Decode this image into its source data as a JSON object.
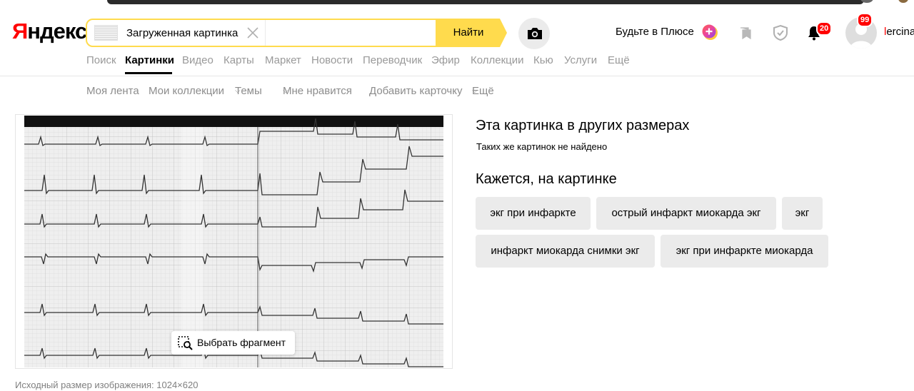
{
  "header": {
    "logo": {
      "first": "Я",
      "rest": "ндекс"
    },
    "search": {
      "query_text": "Загруженная картинка",
      "input_value": "",
      "submit_label": "Найти"
    },
    "plus_label": "Будьте в Плюсе",
    "notifications_count": "20",
    "avatar_badge": "99",
    "user": {
      "first": "l",
      "rest": "ercina"
    }
  },
  "nav": {
    "services": [
      "Поиск",
      "Картинки",
      "Видео",
      "Карты",
      "Маркет",
      "Новости",
      "Переводчик",
      "Эфир",
      "Коллекции",
      "Кью",
      "Услуги",
      "Ещё"
    ],
    "active": "Картинки"
  },
  "subnav": {
    "items": [
      "Моя лента",
      "Мои коллекции",
      "Темы",
      "Мне нравится",
      "Добавить карточку",
      "Ещё"
    ]
  },
  "image": {
    "select_fragment_label": "Выбрать фрагмент",
    "original_size_text": "Исходный размер изображения: 1024×620"
  },
  "results": {
    "other_sizes_title": "Эта картинка в других размерах",
    "not_found_text": "Таких же картинок не найдено",
    "seems_title": "Кажется, на картинке",
    "tags": [
      "экг при инфаркте",
      "острый инфаркт миокарда экг",
      "экг",
      "инфаркт миокарда снимки экг",
      "экг при инфаркте миокарда"
    ]
  },
  "colors": {
    "search_border": "#ffdb4d",
    "find_button": "#ffdb4d",
    "badge": "#ff0000",
    "tag_bg": "#ebebeb",
    "nav_inactive": "#999999"
  },
  "icons": [
    "camera-icon",
    "close-icon",
    "plus-icon",
    "collections-icon",
    "shield-icon",
    "bell-icon",
    "avatar-icon",
    "select-fragment-icon"
  ]
}
